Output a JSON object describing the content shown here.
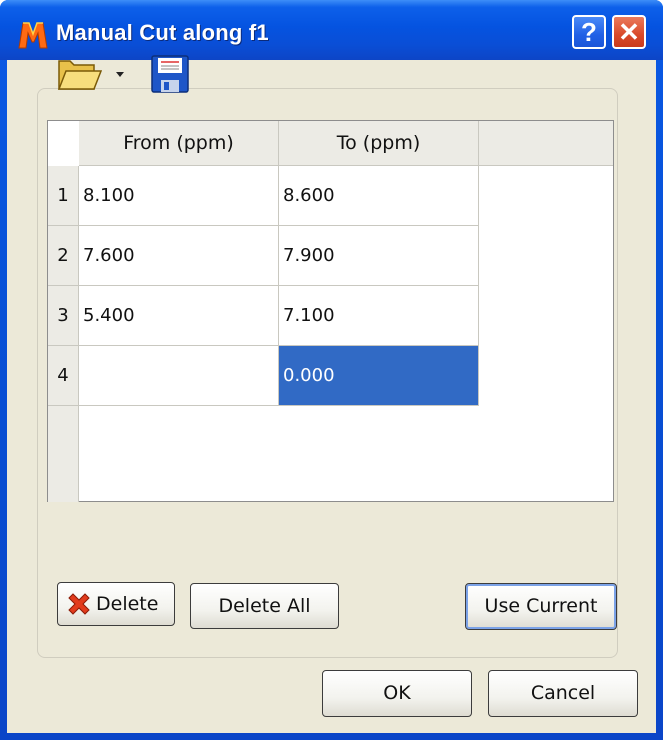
{
  "window": {
    "title": "Manual Cut along f1",
    "help_label": "?",
    "close_label": "✕"
  },
  "toolbar": {
    "icons": [
      "folder-open-icon",
      "dropdown-arrow-icon",
      "save-disk-icon"
    ]
  },
  "table": {
    "columns": [
      "From (ppm)",
      "To (ppm)"
    ],
    "rows": [
      {
        "num": "1",
        "from": "8.100",
        "to": "8.600"
      },
      {
        "num": "2",
        "from": "7.600",
        "to": "7.900"
      },
      {
        "num": "3",
        "from": "5.400",
        "to": "7.100"
      },
      {
        "num": "4",
        "from": "",
        "to": "0.000"
      }
    ],
    "selected_cell": {
      "row": 4,
      "column": "To (ppm)"
    }
  },
  "buttons": {
    "delete": "Delete",
    "delete_all": "Delete All",
    "use_current": "Use Current",
    "ok": "OK",
    "cancel": "Cancel"
  },
  "colors": {
    "title_bar": "#0a59e5",
    "selection": "#316ac5",
    "close_button": "#d9492a"
  }
}
